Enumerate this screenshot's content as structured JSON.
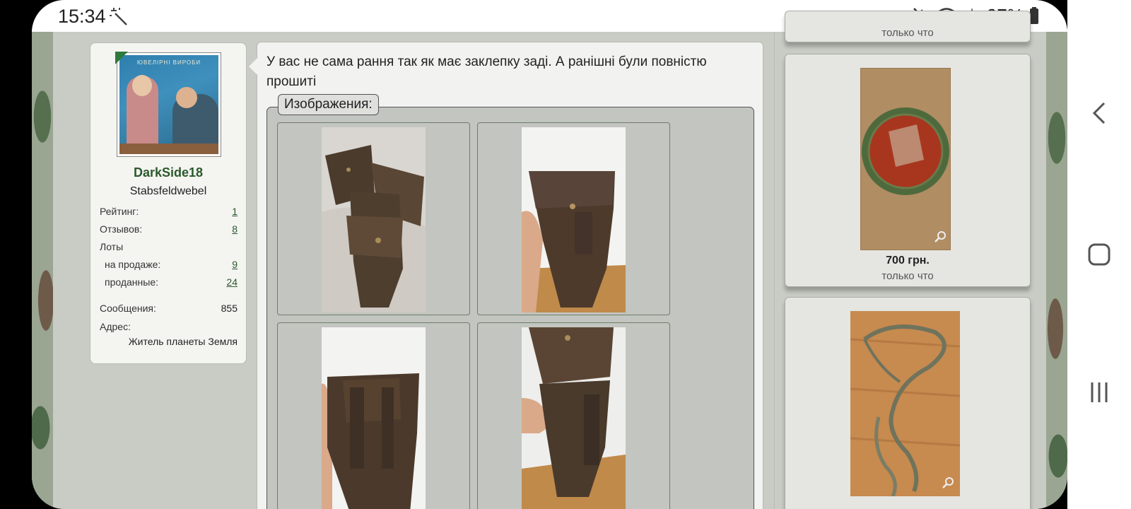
{
  "status_bar": {
    "time": "15:34",
    "battery": "97%",
    "icons": [
      "magic-wand-icon",
      "mute-icon",
      "wifi-icon",
      "airplane-icon",
      "battery-icon"
    ]
  },
  "user": {
    "avatar_caption": "ЮВЕЛІРНІ ВИРОБИ",
    "name": "DarkSide18",
    "rank": "Stabsfeldwebel",
    "rating_label": "Рейтинг:",
    "rating": "1",
    "reviews_label": "Отзывов:",
    "reviews": "8",
    "lots_label": "Лоты",
    "on_sale_label": "на продаже:",
    "on_sale": "9",
    "sold_label": "проданные:",
    "sold": "24",
    "messages_label": "Сообщения:",
    "messages": "855",
    "address_label": "Адрес:",
    "address": "Житель планеты Земля"
  },
  "post": {
    "text": "У вас не сама рання так як має заклепку заді. А ранішні були повністю прошиті",
    "images_label": "Изображения:",
    "images": [
      "holster-photo-1",
      "holster-photo-2",
      "holster-photo-3",
      "holster-photo-4"
    ]
  },
  "sidebar": {
    "lots": [
      {
        "time": "только что"
      },
      {
        "price": "700 грн.",
        "time": "только что"
      },
      {
        "price": "",
        "time": ""
      }
    ]
  },
  "colors": {
    "accent_green": "#2a5a2b",
    "page_bg": "#c9cbc5",
    "card_bg": "#f4f4f1"
  }
}
